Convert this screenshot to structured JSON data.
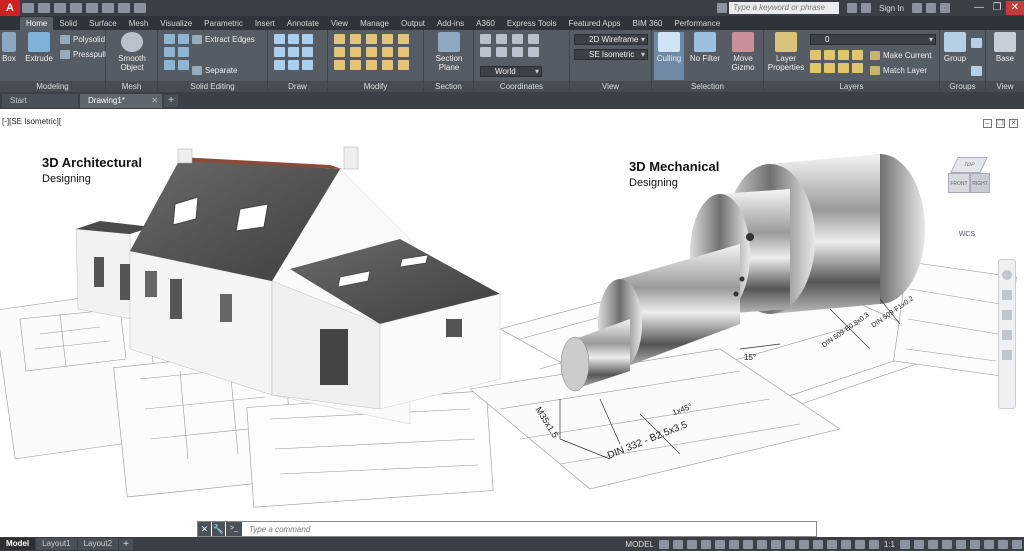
{
  "titlebar": {
    "app_letter": "A",
    "search_placeholder": "Type a keyword or phrase",
    "sign_in": "Sign In",
    "minimize": "—",
    "restore": "❐",
    "close": "✕"
  },
  "tabs": [
    "Home",
    "Solid",
    "Surface",
    "Mesh",
    "Visualize",
    "Parametric",
    "Insert",
    "Annotate",
    "View",
    "Manage",
    "Output",
    "Add-ins",
    "A360",
    "Express Tools",
    "Featured Apps",
    "BIM 360",
    "Performance"
  ],
  "ribbon": {
    "modeling": {
      "title": "Modeling",
      "box": "Box",
      "extrude": "Extrude",
      "polysolid": "Polysolid",
      "presspull": "Presspull"
    },
    "mesh": {
      "title": "Mesh",
      "smooth_l1": "Smooth",
      "smooth_l2": "Object"
    },
    "solid_editing": {
      "title": "Solid Editing",
      "extract_edges": "Extract Edges",
      "separate": "Separate"
    },
    "draw": {
      "title": "Draw"
    },
    "modify": {
      "title": "Modify"
    },
    "section": {
      "title": "Section",
      "btn_l1": "Section",
      "btn_l2": "Plane"
    },
    "coordinates": {
      "title": "Coordinates",
      "world": "World"
    },
    "view": {
      "title": "View",
      "visual_style": "2D Wireframe",
      "view_name": "SE Isometric"
    },
    "selection": {
      "title": "Selection",
      "culling": "Culling",
      "no_filter": "No Filter",
      "move_l1": "Move",
      "move_l2": "Gizmo"
    },
    "layers": {
      "title": "Layers",
      "layer_prop_l1": "Layer",
      "layer_prop_l2": "Properties",
      "layer_value": "0",
      "make_current": "Make Current",
      "match_layer": "Match Layer"
    },
    "groups": {
      "title": "Groups",
      "group": "Group"
    },
    "viewp": {
      "title": "View",
      "base": "Base"
    }
  },
  "filetabs": {
    "start": "Start",
    "drawing": "Drawing1*",
    "close": "✕",
    "add": "+"
  },
  "viewport": {
    "label": "[-][SE Isometric][",
    "arch_title": "3D Architectural",
    "arch_sub": "Designing",
    "mech_title": "3D Mechanical",
    "mech_sub": "Designing",
    "viewcube_top": "TOP",
    "viewcube_front": "FRONT",
    "viewcube_right": "RIGHT",
    "wcs": "WCS",
    "dims": {
      "d1": "M35x1.5",
      "d2": "1x45°",
      "d3": "DIN 332 - B2.5x3.5",
      "d4": "15°",
      "d5": "DIN 509-E0.8x0.3",
      "d6": "DIN 509-F1x0.2"
    },
    "controls": [
      "–",
      "❐",
      "✕"
    ]
  },
  "cmdline": {
    "placeholder": "Type a command",
    "close": "✕",
    "wrench": "🔧",
    "prompt": ">_"
  },
  "statusbar": {
    "model_tab": "Model",
    "layout1": "Layout1",
    "layout2": "Layout2",
    "model_label": "MODEL",
    "scale": "1:1"
  },
  "colors": {
    "ribbon": "#565c63",
    "titlebar": "#3a3f46",
    "accent": "#c22222"
  }
}
